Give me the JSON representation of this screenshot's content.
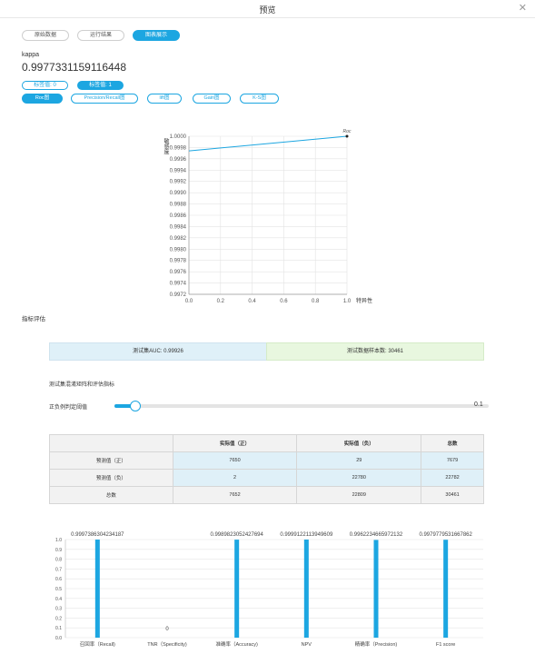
{
  "window": {
    "title": "预览",
    "close_icon": "✕"
  },
  "tabs": [
    {
      "label": "原始数据",
      "active": false
    },
    {
      "label": "运行结果",
      "active": false
    },
    {
      "label": "图表展示",
      "active": true
    }
  ],
  "metric": {
    "label": "kappa",
    "value": "0.9977331159116448"
  },
  "label_buttons": [
    {
      "label": "标签值: 0",
      "active": false
    },
    {
      "label": "标签值: 1",
      "active": true
    }
  ],
  "chart_tabs": [
    {
      "label": "Roc图",
      "active": true
    },
    {
      "label": "Precision/Recall图",
      "active": false
    },
    {
      "label": "lift图",
      "active": false
    },
    {
      "label": "Gain图",
      "active": false
    },
    {
      "label": "K-S图",
      "active": false
    }
  ],
  "section_title": "指标评估",
  "auc": {
    "left": "测试集AUC: 0.99926",
    "right": "测试数据样本数: 30461",
    "left_bg": "#dff0f8",
    "right_bg": "#e8f7df"
  },
  "cm_title": "测试集混淆矩阵和评估指标",
  "slider": {
    "label": "正负例判定阈值",
    "value": "0.1",
    "fraction": 0.1
  },
  "confusion": {
    "headers": [
      "",
      "实际值（正）",
      "实际值（负）",
      "总数"
    ],
    "rows": [
      [
        "预测值（正）",
        "7650",
        "29",
        "7679"
      ],
      [
        "预测值（负）",
        "2",
        "22780",
        "22782"
      ],
      [
        "总数",
        "7652",
        "22809",
        "30461"
      ]
    ]
  },
  "accent_color": "#1ca6e1",
  "chart_data": [
    {
      "type": "line",
      "xlabel": "特异性",
      "ylabel": "敏感度",
      "xlim": [
        0,
        1.0
      ],
      "ylim": [
        0.9972,
        1.0
      ],
      "xticks": [
        "0.0",
        "0.2",
        "0.4",
        "0.6",
        "0.8",
        "1.0"
      ],
      "yticks": [
        "0.9972",
        "0.9974",
        "0.9976",
        "0.9978",
        "0.9980",
        "0.9982",
        "0.9984",
        "0.9986",
        "0.9988",
        "0.9990",
        "0.9992",
        "0.9994",
        "0.9996",
        "0.9998",
        "1.0000"
      ],
      "series": [
        {
          "name": "Roc",
          "x": [
            0.0,
            1.0
          ],
          "y": [
            0.99974,
            1.0
          ]
        }
      ],
      "grid": true
    },
    {
      "type": "bar",
      "categories": [
        "召回率（Recall)",
        "TNR（Specificity)",
        "准确率（Accuracy)",
        "NPV",
        "精确率（Precision)",
        "F1 score"
      ],
      "values": [
        0.9997386304234187,
        0,
        0.9989823052427694,
        0.9999122113949609,
        0.9962234665972132,
        0.9979779531667862
      ],
      "value_labels": [
        "0.9997386304234187",
        "0",
        "0.9989823052427694",
        "0.9999122113949609",
        "0.9962234665972132",
        "0.9979779531667862"
      ],
      "yticks": [
        "0.0",
        "0.1",
        "0.2",
        "0.3",
        "0.4",
        "0.5",
        "0.6",
        "0.7",
        "0.8",
        "0.9",
        "1.0"
      ],
      "ylim": [
        0,
        1.0
      ],
      "grid": true
    }
  ]
}
